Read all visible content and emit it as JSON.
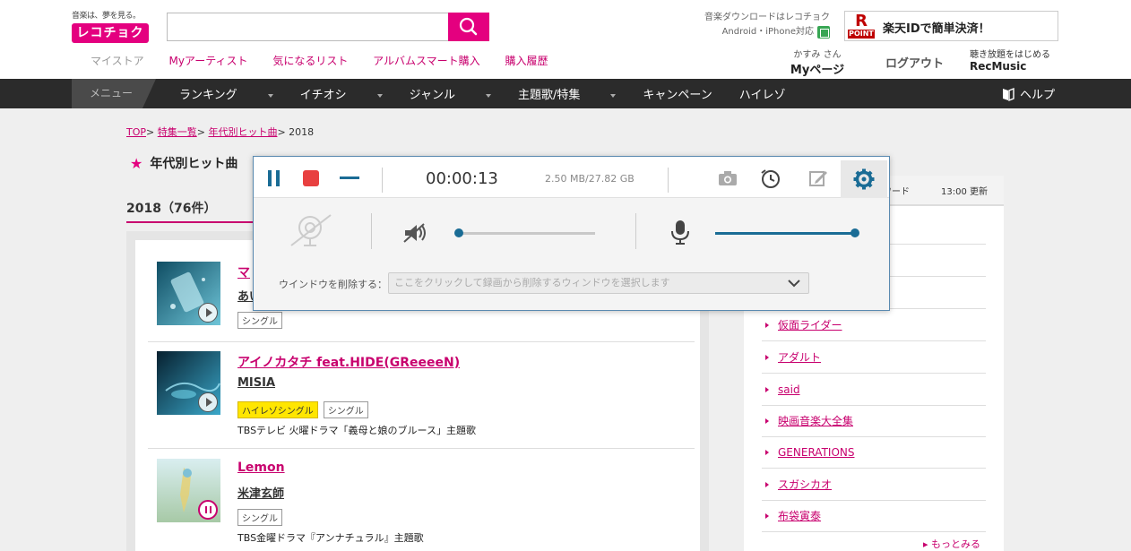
{
  "header": {
    "logo_tagline": "音楽は、夢を見る。",
    "logo_text": "レコチョク",
    "search_placeholder": "",
    "nav": [
      "マイストア",
      "Myアーティスト",
      "気になるリスト",
      "アルバムスマート購入",
      "購入履歴"
    ],
    "download_line1": "音楽ダウンロードはレコチョク",
    "download_line2": "Android・iPhone対応",
    "rakuten_r": "R",
    "rakuten_point": "POINT",
    "rakuten_text": "楽天IDで簡単決済！",
    "user_name": "かすみ さん",
    "mypage": "Myページ",
    "logout": "ログアウト",
    "recmusic_line1": "聴き放題をはじめる",
    "recmusic_line2": "RecMusic"
  },
  "mainnav": {
    "menu": "メニュー",
    "items": [
      {
        "label": "ランキング",
        "dropdown": true
      },
      {
        "label": "イチオシ",
        "dropdown": true
      },
      {
        "label": "ジャンル",
        "dropdown": true
      },
      {
        "label": "主題歌/特集",
        "dropdown": true
      },
      {
        "label": "キャンペーン",
        "dropdown": false
      },
      {
        "label": "ハイレゾ",
        "dropdown": false
      }
    ],
    "help": "ヘルプ"
  },
  "breadcrumb": {
    "top": "TOP",
    "special": "特集一覧",
    "hits": "年代別ヒット曲",
    "current": "2018"
  },
  "page_title": "年代別ヒット曲",
  "year_title": "2018（76件）",
  "songs": [
    {
      "title": "マ",
      "artist": "あい",
      "tags": [
        "シングル"
      ],
      "desc": "",
      "state": "play",
      "colors": [
        "#0f4d63",
        "#6fc5d8"
      ]
    },
    {
      "title": "アイノカタチ feat.HIDE(GReeeeN)",
      "artist": "MISIA",
      "tags": [
        "ハイレゾシングル",
        "シングル"
      ],
      "desc": "TBSテレビ 火曜ドラマ「義母と娘のブルース」主題歌",
      "state": "play",
      "colors": [
        "#0a2f45",
        "#3aa7c9"
      ]
    },
    {
      "title": "Lemon",
      "artist": "米津玄師",
      "tags": [
        "シングル"
      ],
      "desc": "TBS金曜ドラマ『アンナチュラル』主題歌",
      "state": "pause",
      "colors": [
        "#cfe7ea",
        "#a7c9a6"
      ]
    }
  ],
  "sidebar": {
    "keyword_header": "ワード",
    "update": "13:00 更新",
    "keywords": [
      "仮面ライダー",
      "アダルト",
      "said",
      "映画音楽大全集",
      "GENERATIONS",
      "スガシカオ",
      "布袋寅泰"
    ],
    "more": "もっとみる"
  },
  "recorder": {
    "timer": "00:00:13",
    "size": "2.50 MB/27.82 GB",
    "speaker_level": 0.0,
    "mic_level": 1.0,
    "exclude_label": "ウインドウを削除する：",
    "exclude_placeholder": "ここをクリックして録画から削除するウィンドウを選択します"
  },
  "colors": {
    "accent": "#e4007f",
    "link": "#c8006e",
    "recorder_blue": "#1a6c95",
    "stop_red": "#e84040",
    "hires_yellow": "#ffe600"
  }
}
